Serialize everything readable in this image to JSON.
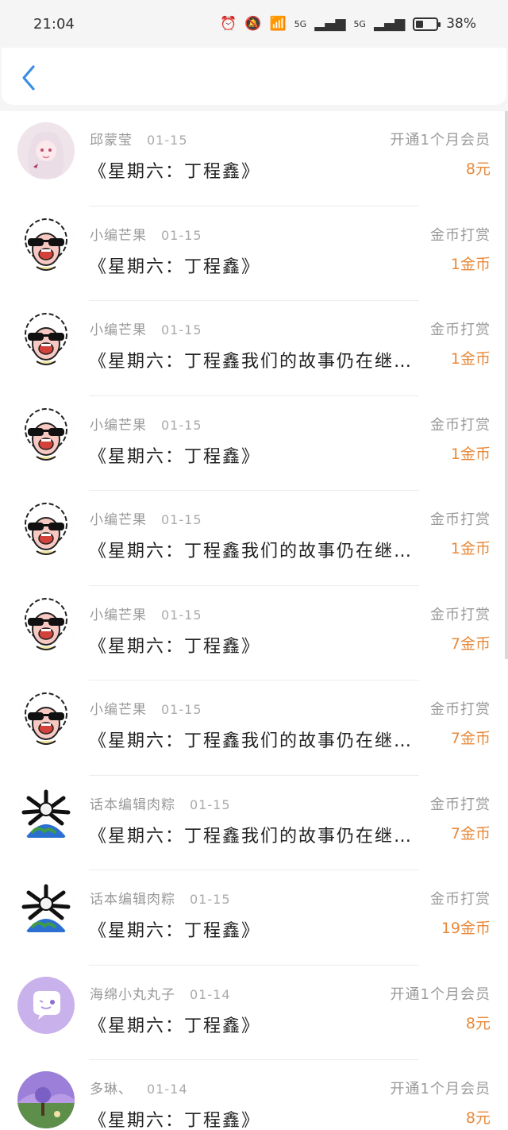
{
  "status_bar": {
    "time": "21:04",
    "network_1": "5G",
    "network_2": "5G",
    "battery_percent": "38%"
  },
  "header": {
    "back_icon": "chevron-left-icon",
    "accent": "#3a8ee6"
  },
  "rows": [
    {
      "name": "邱蒙莹",
      "date": "01-15",
      "title": "《星期六：丁程鑫》",
      "type": "开通1个月会员",
      "amount": "8元",
      "avatar": "girl-avatar"
    },
    {
      "name": "小编芒果",
      "date": "01-15",
      "title": "《星期六：丁程鑫》",
      "type": "金币打赏",
      "amount": "1金币",
      "avatar": "sheep-sunglasses-avatar"
    },
    {
      "name": "小编芒果",
      "date": "01-15",
      "title": "《星期六：丁程鑫我们的故事仍在继…",
      "type": "金币打赏",
      "amount": "1金币",
      "avatar": "sheep-sunglasses-avatar"
    },
    {
      "name": "小编芒果",
      "date": "01-15",
      "title": "《星期六：丁程鑫》",
      "type": "金币打赏",
      "amount": "1金币",
      "avatar": "sheep-sunglasses-avatar"
    },
    {
      "name": "小编芒果",
      "date": "01-15",
      "title": "《星期六：丁程鑫我们的故事仍在继…",
      "type": "金币打赏",
      "amount": "1金币",
      "avatar": "sheep-sunglasses-avatar"
    },
    {
      "name": "小编芒果",
      "date": "01-15",
      "title": "《星期六：丁程鑫》",
      "type": "金币打赏",
      "amount": "7金币",
      "avatar": "sheep-sunglasses-avatar"
    },
    {
      "name": "小编芒果",
      "date": "01-15",
      "title": "《星期六：丁程鑫我们的故事仍在继…",
      "type": "金币打赏",
      "amount": "7金币",
      "avatar": "sheep-sunglasses-avatar"
    },
    {
      "name": "话本编辑肉粽",
      "date": "01-15",
      "title": "《星期六：丁程鑫我们的故事仍在继…",
      "type": "金币打赏",
      "amount": "7金币",
      "avatar": "earth-creature-avatar"
    },
    {
      "name": "话本编辑肉粽",
      "date": "01-15",
      "title": "《星期六：丁程鑫》",
      "type": "金币打赏",
      "amount": "19金币",
      "avatar": "earth-creature-avatar"
    },
    {
      "name": "海绵小丸丸子",
      "date": "01-14",
      "title": "《星期六：丁程鑫》",
      "type": "开通1个月会员",
      "amount": "8元",
      "avatar": "purple-chat-avatar"
    },
    {
      "name": "多琳、",
      "date": "01-14",
      "title": "《星期六：丁程鑫》",
      "type": "开通1个月会员",
      "amount": "8元",
      "avatar": "scenery-avatar"
    }
  ],
  "colors": {
    "amount": "#e8893a",
    "secondary_text": "#999999"
  }
}
